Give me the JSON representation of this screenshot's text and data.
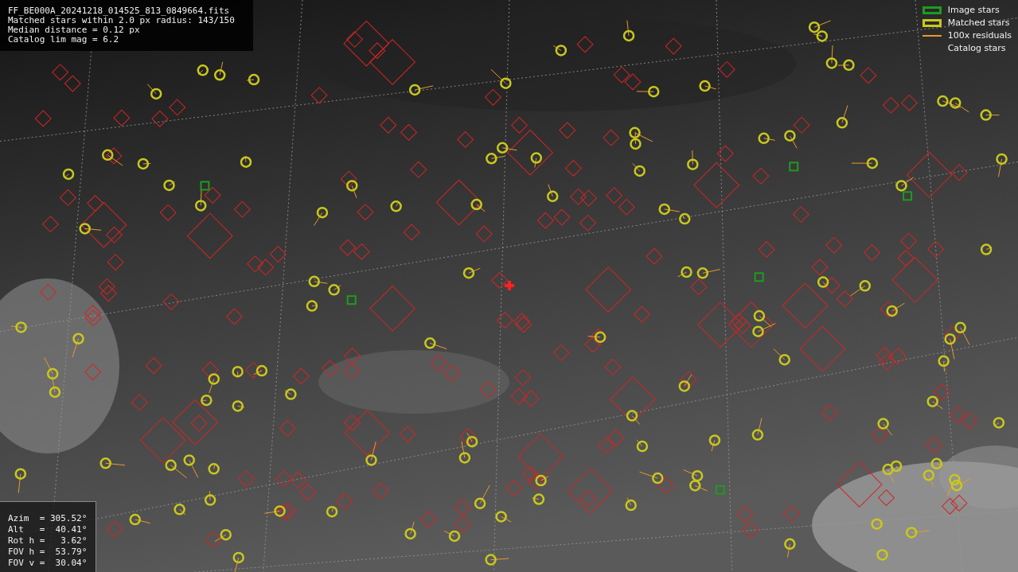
{
  "header": {
    "lines": [
      "FF_BE000A_20241218_014525_813_0849664.fits",
      "Matched stars within 2.0 px radius: 143/150",
      "Median distance = 0.12 px",
      "Catalog lim mag = 6.2"
    ]
  },
  "legend": [
    {
      "label": "Image stars",
      "kind": "box",
      "color": "#1f9a1f"
    },
    {
      "label": "Matched stars",
      "kind": "box",
      "color": "#c8c81e"
    },
    {
      "label": "100x residuals",
      "kind": "line",
      "color": "#e89a2a"
    },
    {
      "label": "Catalog stars",
      "kind": "none"
    }
  ],
  "pointing": {
    "lines": [
      "Azim  = 305.52°",
      "Alt   =  40.41°",
      "Rot h =   3.62°",
      "FOV h =  53.79°",
      "FOV v =  30.04°"
    ]
  }
}
